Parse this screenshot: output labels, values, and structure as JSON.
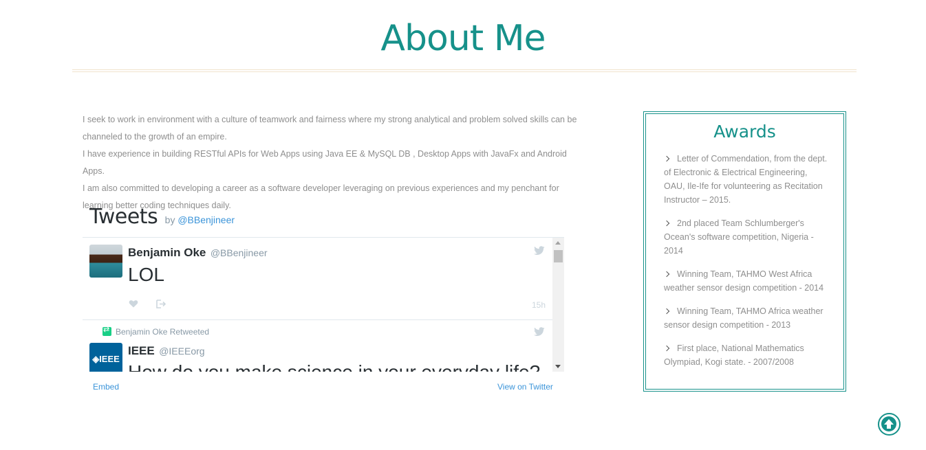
{
  "header": {
    "title": "About Me"
  },
  "about": {
    "lines": [
      "I seek to work in environment with a culture of teamwork and fairness where my strong analytical and problem solved skills can be channeled to the growth of an empire.",
      "I have experience in building RESTful APIs for Web Apps using Java EE & MySQL DB , Desktop Apps with JavaFx and Android Apps.",
      "I am also committed to developing a career as a software developer leveraging on previous experiences and my penchant for learning better coding techniques daily."
    ]
  },
  "twitter": {
    "title": "Tweets",
    "by_label": "by",
    "handle": "@BBenjineer",
    "tweets": [
      {
        "name": "Benjamin Oke",
        "handle": "@BBenjineer",
        "text": "LOL",
        "time": "15h"
      },
      {
        "retweet_label": "Benjamin Oke Retweeted",
        "avatar_label": "◈IEEE",
        "name": "IEEE",
        "handle": "@IEEEorg",
        "text": "How do you make science in your everyday life?"
      }
    ],
    "embed_label": "Embed",
    "view_label": "View on Twitter"
  },
  "awards": {
    "title": "Awards",
    "items": [
      "Letter of Commendation, from the dept. of Electronic & Electrical Engineering, OAU, Ile-Ife for volunteering as Recitation Instructor – 2015.",
      "2nd placed Team Schlumberger's Ocean's software competition, Nigeria - 2014",
      "Winning Team, TAHMO West Africa weather sensor design competition - 2014",
      "Winning Team, TAHMO Africa weather sensor design competition - 2013",
      "First place, National Mathematics Olympiad, Kogi state. - 2007/2008"
    ]
  },
  "colors": {
    "accent": "#16918a",
    "link": "#3b94d9",
    "text_muted": "#8e8e8e"
  },
  "icons": [
    "chevron-right-icon",
    "heart-icon",
    "share-icon",
    "twitter-bird-icon",
    "retweet-icon",
    "arrow-up-icon"
  ]
}
